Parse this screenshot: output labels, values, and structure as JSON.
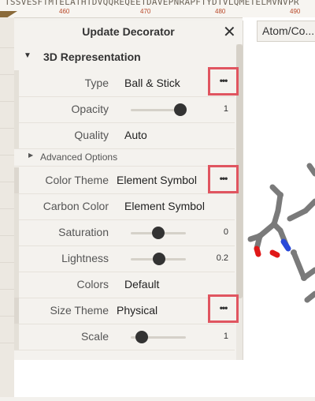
{
  "sequence": {
    "text": "TSSVESFTMTELATHTDVQQREQEETDAVEPNRAPFTYDTVLQMETELMVNVPR",
    "numbers": [
      "460",
      "470",
      "480",
      "490"
    ]
  },
  "panel": {
    "title": "Update Decorator",
    "close_icon": "✕",
    "section_title": "3D Representation",
    "rows": {
      "type": {
        "label": "Type",
        "value": "Ball & Stick"
      },
      "opacity": {
        "label": "Opacity",
        "value": "1",
        "level": 0.9
      },
      "quality": {
        "label": "Quality",
        "value": "Auto"
      },
      "advanced": {
        "label": "Advanced Options"
      },
      "color_theme": {
        "label": "Color Theme",
        "value": "Element Symbol"
      },
      "carbon_color": {
        "label": "Carbon Color",
        "value": "Element Symbol"
      },
      "saturation": {
        "label": "Saturation",
        "value": "0",
        "level": 0.5
      },
      "lightness": {
        "label": "Lightness",
        "value": "0.2",
        "level": 0.52
      },
      "colors": {
        "label": "Colors",
        "value": "Default"
      },
      "size_theme": {
        "label": "Size Theme",
        "value": "Physical"
      },
      "scale": {
        "label": "Scale",
        "value": "1",
        "level": 0.2
      }
    },
    "more_icon": "•••"
  },
  "toolbar": {
    "atom_button": "Atom/Co..."
  },
  "colors": {
    "highlight": "#e05560",
    "carbon": "#7a7a7a",
    "nitrogen": "#2a4ad8",
    "oxygen": "#e01818"
  }
}
